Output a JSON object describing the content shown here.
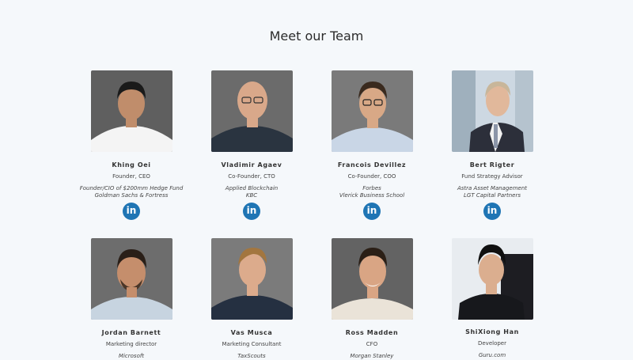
{
  "page": {
    "title": "Meet our Team"
  },
  "team": [
    {
      "name": "Khing Oei",
      "role": "Founder, CEO",
      "exp1": "Founder/CIO of $200mm Hedge Fund",
      "exp2": "Goldman Sachs & Fortress",
      "linkedin": "in"
    },
    {
      "name": "Vladimir Agaev",
      "role": "Co-Founder, CTO",
      "exp1": "Applied Blockchain",
      "exp2": "KBC",
      "linkedin": "in"
    },
    {
      "name": "Francois Devillez",
      "role": "Co-Founder, COO",
      "exp1": "Forbes",
      "exp2": "Vlerick Business School",
      "linkedin": "in"
    },
    {
      "name": "Bert Rigter",
      "role": "Fund Strategy Advisor",
      "exp1": "Astra Asset Management",
      "exp2": "LGT Capital Partners",
      "linkedin": "in"
    },
    {
      "name": "Jordan Barnett",
      "role": "Marketing director",
      "exp1": "Microsoft",
      "exp2": ""
    },
    {
      "name": "Vas Musca",
      "role": "Marketing Consultant",
      "exp1": "TaxScouts",
      "exp2": ""
    },
    {
      "name": "Ross Madden",
      "role": "CFO",
      "exp1": "Morgan Stanley",
      "exp2": ""
    },
    {
      "name": "ShiXiong Han",
      "role": "Developer",
      "exp1": "Guru.com",
      "exp2": ""
    }
  ],
  "colors": {
    "background": "#f5f8fb",
    "linkedin": "#1f75b4"
  },
  "icons": {
    "linkedin": "linkedin-icon",
    "photo": "portrait-photo"
  }
}
